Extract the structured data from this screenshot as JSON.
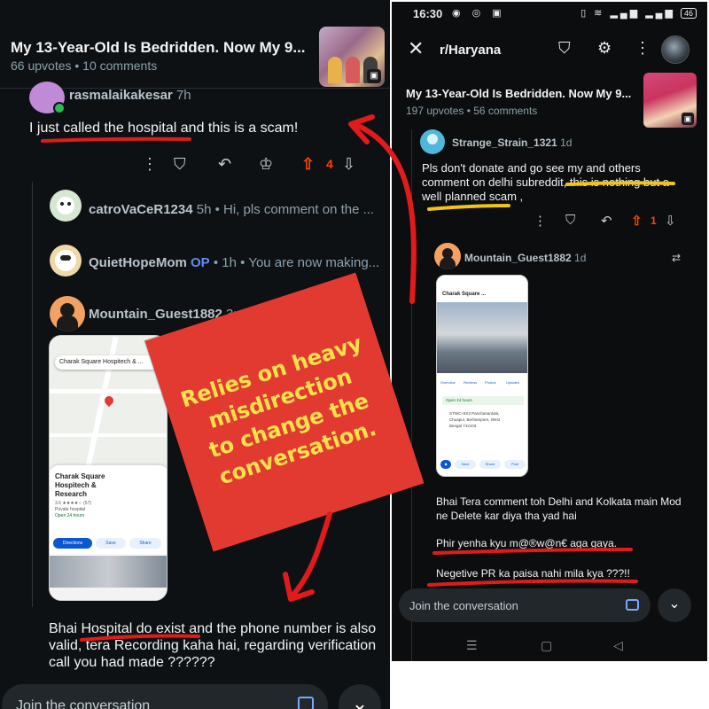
{
  "left_screen": {
    "post_title": "My 13-Year-Old Is Bedridden. Now My 9...",
    "post_meta": "66 upvotes  •  10 comments",
    "comment1": {
      "user": "rasmalaikakesar",
      "age": "7h",
      "text": "I just called the hospital and this is a scam!",
      "votes": "4"
    },
    "reply1": {
      "user": "catroVaCeR1234",
      "age": "5h",
      "preview": "Hi, pls comment on the ..."
    },
    "reply2": {
      "user": "QuietHopeMom",
      "op": "OP",
      "age": "1h",
      "preview": "You are now making..."
    },
    "comment2": {
      "user": "Mountain_Guest1882",
      "age": "3m",
      "text": "Bhai Hospital do exist and the phone number is also valid, tera Recording kaha hai, regarding verification call you had made ??????"
    },
    "map_shot": {
      "search": "Charak Square Hospitech & ...",
      "place": "Charak Square Hospitech & Research",
      "rating": "3.6 ★★★★☆ (57)",
      "type": "Private hospital",
      "hours": "Open 24 hours",
      "buttons": [
        "Directions",
        "Save",
        "Share"
      ]
    },
    "join": "Join the conversation"
  },
  "right_screen": {
    "status_time": "16:30",
    "battery": "46",
    "subreddit": "r/Haryana",
    "post_title": "My 13-Year-Old Is Bedridden. Now My 9...",
    "post_meta": "197 upvotes  •  56 comments",
    "comment1": {
      "user": "Strange_Strain_1321",
      "age": "1d",
      "text": "Pls don't donate and go see my and others comment on delhi subreddit, this is nothing but a well planned scam ,",
      "votes": "1"
    },
    "comment2": {
      "user": "Mountain_Guest1882",
      "age": "1d",
      "lines": [
        "Bhai Tera comment toh Delhi and Kolkata main Mod ne Delete kar diya tha yad hai",
        "Phir yenha kyu m@®w@n€ aga gaya.",
        "Negetive PR ka paisa nahi mila kya ???!!"
      ]
    },
    "map_shot": {
      "title": "Charak Square ...",
      "tabs": [
        "Overview",
        "Reviews",
        "Photos",
        "Updates"
      ],
      "hours": "Open 24 hours",
      "address": "STWC+8X3 Panchanantala, Chuapur, Berhampore, West Bengal 742103",
      "buttons": [
        "Save",
        "Share",
        "Post"
      ]
    },
    "join": "Join the conversation"
  },
  "callout": {
    "lines": [
      "Relies on heavy",
      "misdirection",
      "to change the",
      "conversation."
    ]
  },
  "colors": {
    "callout_bg": "#e23a31",
    "callout_text": "#ffe14d",
    "annot_red": "#e11b1b",
    "annot_yellow": "#f2c418",
    "upvote": "#ff4500"
  }
}
